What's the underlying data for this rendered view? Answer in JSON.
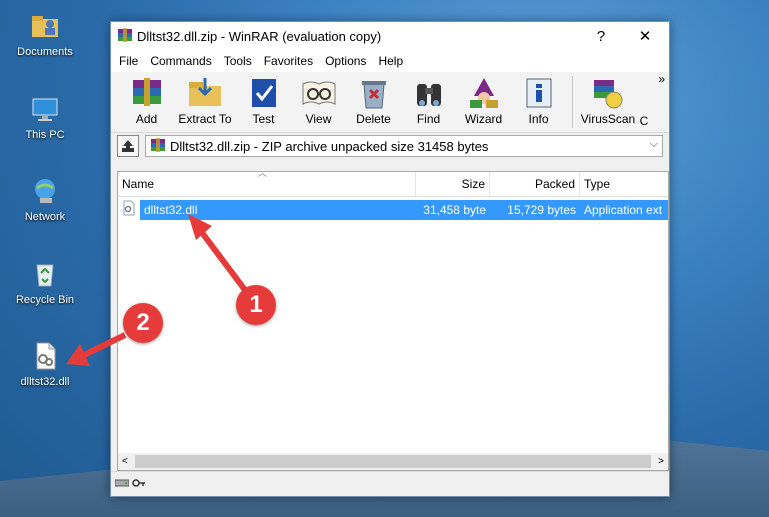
{
  "desktop": {
    "icons": [
      {
        "label": "Documents",
        "icon": "folder-user-icon"
      },
      {
        "label": "This PC",
        "icon": "computer-icon"
      },
      {
        "label": "Network",
        "icon": "network-icon"
      },
      {
        "label": "Recycle Bin",
        "icon": "recycle-bin-icon"
      },
      {
        "label": "dlltst32.dll",
        "icon": "dll-file-icon"
      }
    ]
  },
  "window": {
    "title": "Dlltst32.dll.zip - WinRAR (evaluation copy)",
    "help_glyph": "?",
    "close_glyph": "✕"
  },
  "menu": [
    "File",
    "Commands",
    "Tools",
    "Favorites",
    "Options",
    "Help"
  ],
  "toolbar": {
    "buttons": [
      "Add",
      "Extract To",
      "Test",
      "View",
      "Delete",
      "Find",
      "Wizard",
      "Info",
      "VirusScan",
      "C"
    ],
    "overflow_glyph": "»"
  },
  "address": {
    "text": "Dlltst32.dll.zip - ZIP archive unpacked size 31458 bytes"
  },
  "filelist": {
    "columns": [
      "Name",
      "Size",
      "Packed",
      "Type"
    ],
    "rows": [
      {
        "name": "dlltst32.dll",
        "size": "31,458 byte",
        "packed": "15,729 bytes",
        "type": "Application ext",
        "selected": true
      }
    ]
  },
  "callouts": [
    "1",
    "2"
  ],
  "colors": {
    "accent": "#3399ff",
    "callout": "#e53b3b"
  }
}
